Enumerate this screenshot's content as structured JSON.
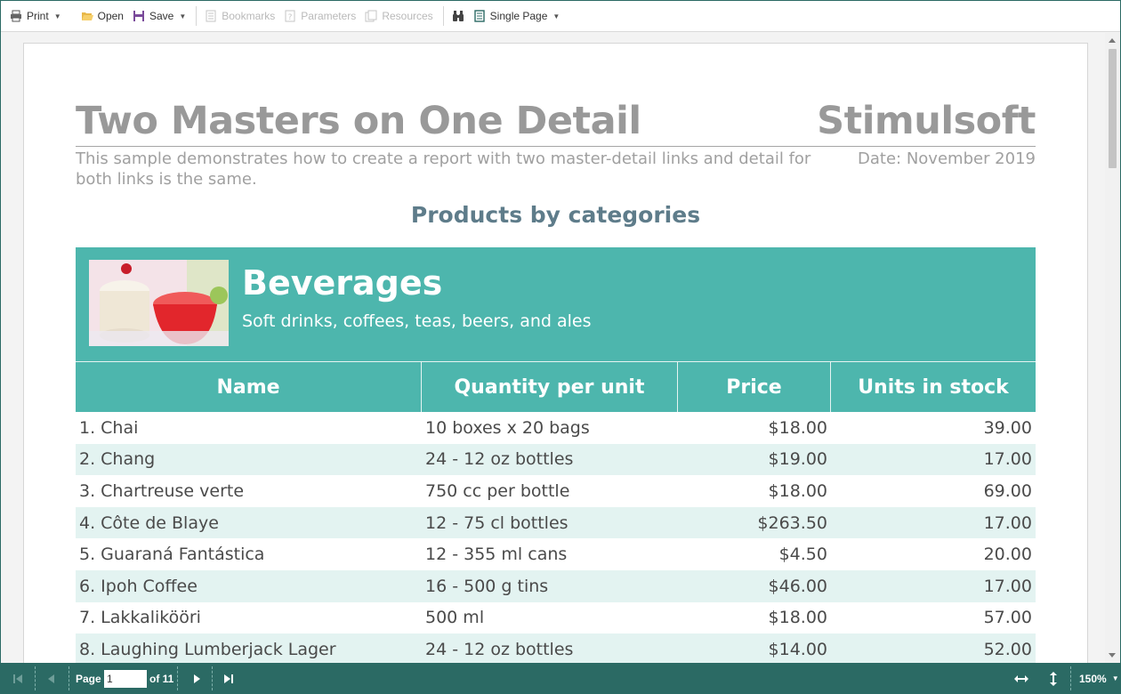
{
  "toolbar": {
    "print": "Print",
    "open": "Open",
    "save": "Save",
    "bookmarks": "Bookmarks",
    "parameters": "Parameters",
    "resources": "Resources",
    "view_mode": "Single Page"
  },
  "report": {
    "title": "Two Masters on One Detail",
    "brand": "Stimulsoft",
    "description": "This sample demonstrates how to create a report with two master-detail links and detail for both links is the same.",
    "date": "Date: November 2019",
    "subtitle": "Products by categories",
    "category": {
      "name": "Beverages",
      "description": "Soft drinks, coffees, teas, beers, and ales"
    },
    "columns": [
      "Name",
      "Quantity per unit",
      "Price",
      "Units in stock"
    ],
    "rows": [
      [
        "1. Chai",
        "10 boxes x 20 bags",
        "$18.00",
        "39.00"
      ],
      [
        "2. Chang",
        "24 - 12 oz bottles",
        "$19.00",
        "17.00"
      ],
      [
        "3. Chartreuse verte",
        "750 cc per bottle",
        "$18.00",
        "69.00"
      ],
      [
        "4. Côte de Blaye",
        "12 - 75 cl bottles",
        "$263.50",
        "17.00"
      ],
      [
        "5. Guaraná Fantástica",
        "12 - 355 ml cans",
        "$4.50",
        "20.00"
      ],
      [
        "6. Ipoh Coffee",
        "16 - 500 g tins",
        "$46.00",
        "17.00"
      ],
      [
        "7. Lakkalikööri",
        "500 ml",
        "$18.00",
        "57.00"
      ],
      [
        "8. Laughing Lumberjack Lager",
        "24 - 12 oz bottles",
        "$14.00",
        "52.00"
      ]
    ]
  },
  "statusbar": {
    "page_label": "Page",
    "page_value": "1",
    "of_label": "of 11",
    "zoom": "150%"
  },
  "colors": {
    "accent": "#4db6ad",
    "statusbar": "#2b6a64",
    "row_alt": "#e3f3f1"
  }
}
